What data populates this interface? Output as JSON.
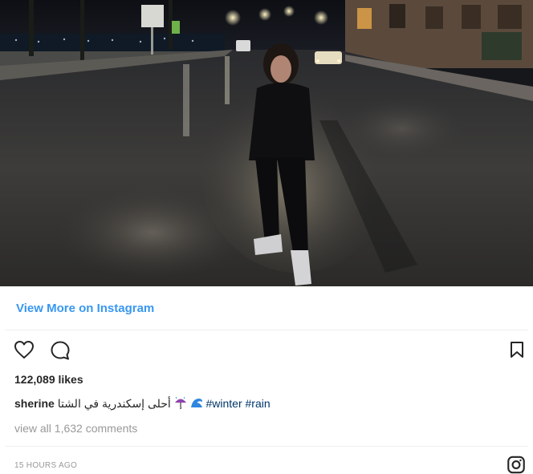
{
  "view_more": {
    "label": "View More on Instagram",
    "color": "#3897f0"
  },
  "actions": {
    "like_icon": "heart-outline-icon",
    "comment_icon": "comment-bubble-icon",
    "save_icon": "bookmark-icon"
  },
  "post": {
    "likes": "122,089 likes",
    "username": "sherine",
    "caption_arabic": "أحلى إسكندرية في الشتا",
    "caption_emojis": [
      "umbrella-rain-emoji",
      "wave-emoji"
    ],
    "hashtags": [
      "#winter",
      "#rain"
    ],
    "comments_link": "view all 1,632 comments",
    "timestamp": "15 HOURS AGO"
  },
  "footer": {
    "brand_icon": "instagram-logo-icon"
  }
}
